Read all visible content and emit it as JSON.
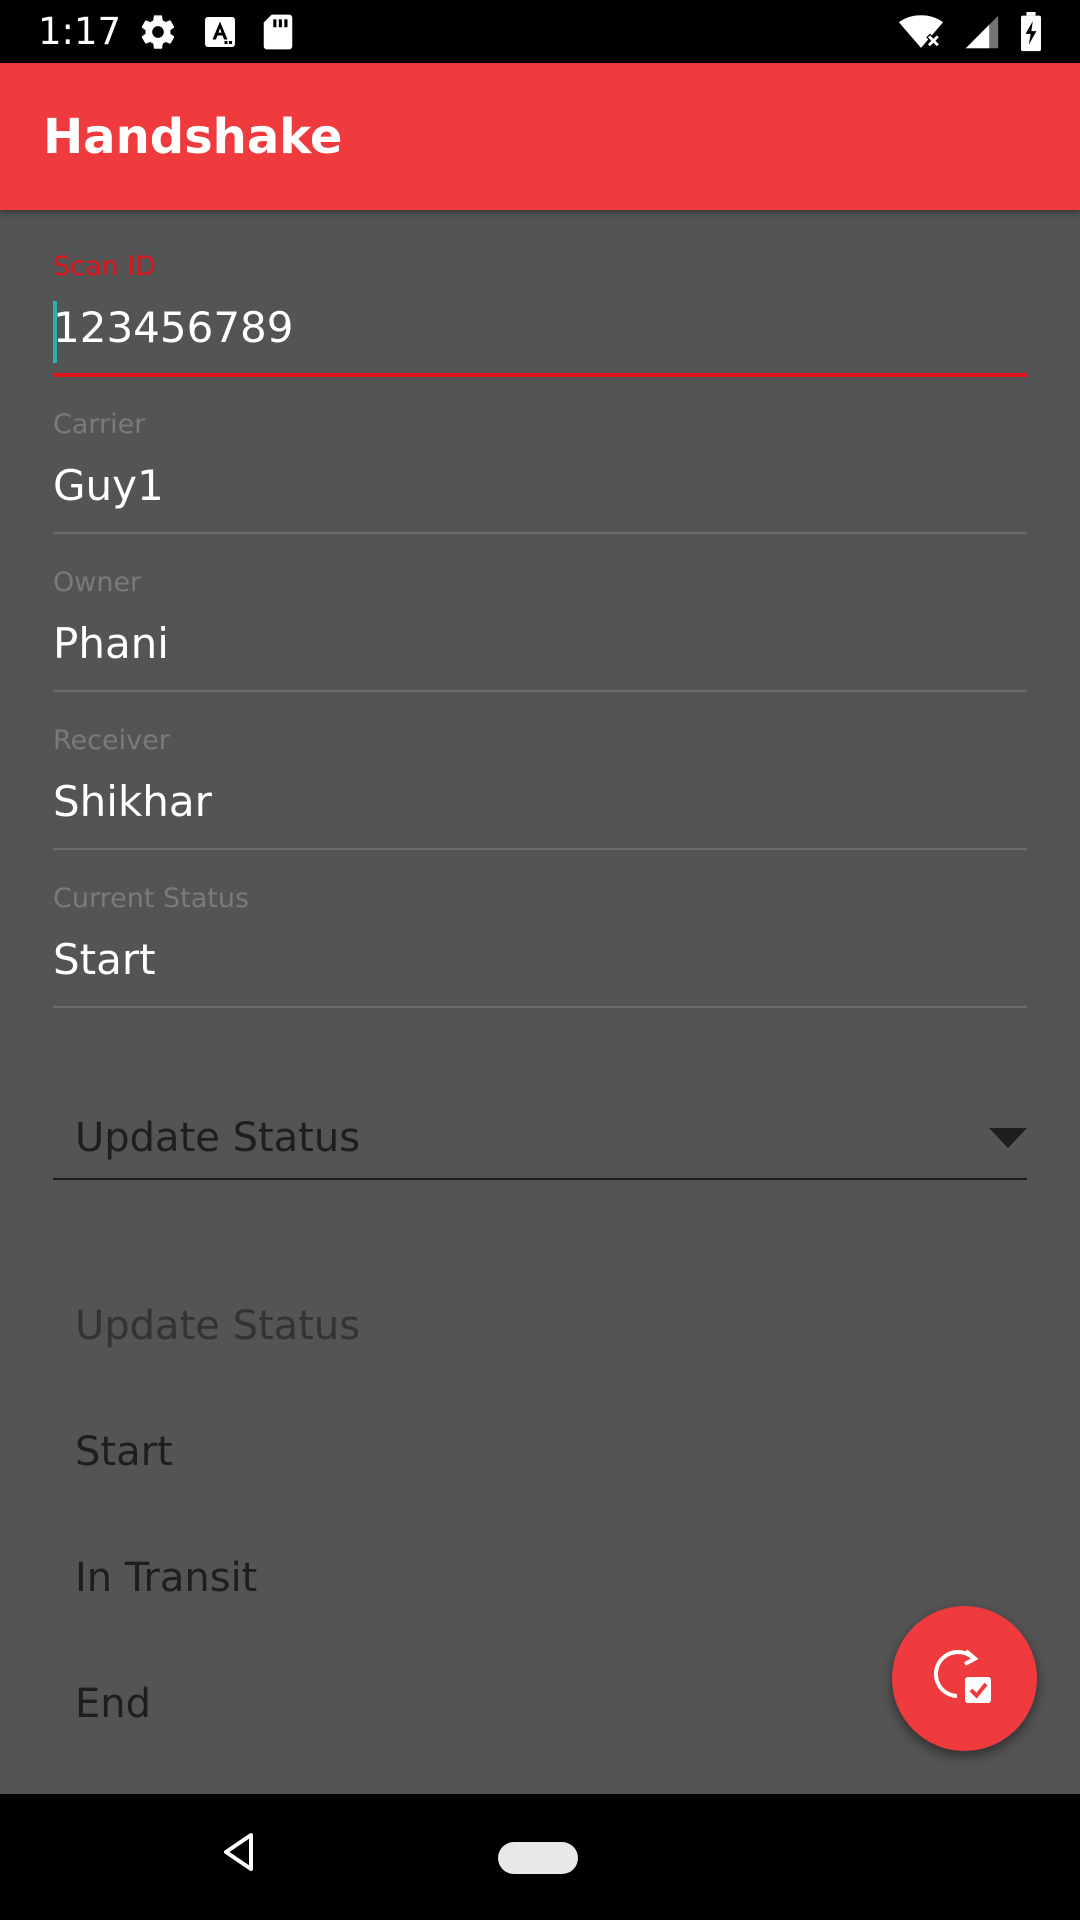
{
  "status_bar": {
    "time": "1:17",
    "left_icons": [
      "settings-icon",
      "text-a-icon",
      "sd-card-icon"
    ],
    "right_icons": [
      "wifi-off-icon",
      "signal-icon",
      "battery-charging-icon"
    ]
  },
  "app_bar": {
    "title": "Handshake",
    "color": "#ef3a3e"
  },
  "form": {
    "scan_id": {
      "label": "Scan ID",
      "value": "123456789"
    },
    "carrier": {
      "label": "Carrier",
      "value": "Guy1"
    },
    "owner": {
      "label": "Owner",
      "value": "Phani"
    },
    "receiver": {
      "label": "Receiver",
      "value": "Shikhar"
    },
    "current_status": {
      "label": "Current Status",
      "value": "Start"
    }
  },
  "update_status": {
    "selected": "Update Status",
    "options": [
      "Update Status",
      "Start",
      "In Transit",
      "End"
    ]
  },
  "fab": {
    "icon": "refresh-check-icon"
  },
  "nav": {
    "icons": [
      "back-icon",
      "home-icon"
    ]
  },
  "colors": {
    "accent": "#e0121a",
    "cursor": "#2bb3a6",
    "background": "#545454"
  }
}
